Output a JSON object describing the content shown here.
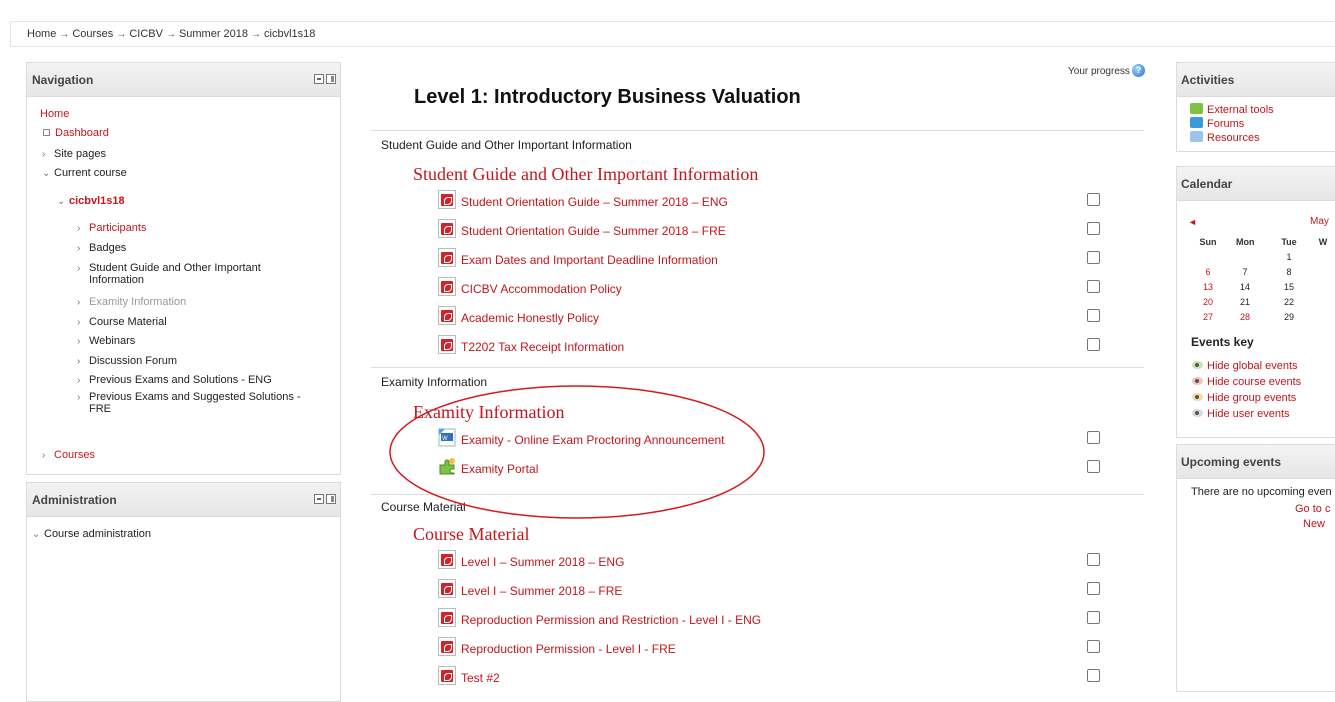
{
  "breadcrumb": [
    "Home",
    "Courses",
    "CICBV",
    "Summer 2018",
    "cicbvl1s18"
  ],
  "breadcrumb_sep": "→",
  "navigation": {
    "title": "Navigation",
    "home": "Home",
    "dashboard": "Dashboard",
    "site_pages": "Site pages",
    "current_course": "Current course",
    "course_code": "cicbvl1s18",
    "course_items": [
      "Participants",
      "Badges",
      "Student Guide and Other Important",
      "Information",
      "Examity Information",
      "Course Material",
      "Webinars",
      "Discussion Forum",
      "Previous Exams and Solutions - ENG",
      "Previous Exams and Suggested Solutions -",
      "FRE"
    ],
    "courses": "Courses"
  },
  "administration": {
    "title": "Administration",
    "course_admin": "Course administration"
  },
  "main": {
    "progress_label": "Your progress",
    "help_glyph": "?",
    "course_title": "Level 1: Introductory Business Valuation",
    "sections": [
      {
        "title": "Student Guide and Other Important Information",
        "heading": "Student Guide and Other Important Information",
        "activities": [
          "Student Orientation Guide – Summer 2018 – ENG",
          "Student Orientation Guide – Summer 2018 – FRE",
          "Exam Dates and Important Deadline Information",
          "CICBV Accommodation Policy",
          "Academic Honestly Policy",
          "T2202 Tax Receipt Information"
        ]
      },
      {
        "title": "Examity Information",
        "heading": "Examity Information",
        "activities": [
          "Examity - Online Exam Proctoring Announcement",
          "Examity Portal"
        ]
      },
      {
        "title": "Course Material",
        "heading": "Course Material",
        "activities": [
          "Level I – Summer 2018 – ENG",
          "Level I – Summer 2018 – FRE",
          "Reproduction Permission and Restriction - Level I - ENG",
          "Reproduction Permission - Level I - FRE",
          "Test #2"
        ]
      }
    ]
  },
  "activities_block": {
    "title": "Activities",
    "items": [
      "External tools",
      "Forums",
      "Resources"
    ]
  },
  "calendar": {
    "title": "Calendar",
    "month": "May",
    "prev_glyph": "◄",
    "days": [
      "Sun",
      "Mon",
      "Tue",
      "W"
    ],
    "rows": [
      [
        "",
        "",
        "1"
      ],
      [
        "6",
        "7",
        "8"
      ],
      [
        "13",
        "14",
        "15"
      ],
      [
        "20",
        "21",
        "22"
      ],
      [
        "27",
        "28",
        "29"
      ]
    ],
    "events_key_title": "Events key",
    "events": [
      "Hide global events",
      "Hide course events",
      "Hide group events",
      "Hide user events"
    ]
  },
  "upcoming": {
    "title": "Upcoming events",
    "empty_text": "There are no upcoming even",
    "goto": "Go to c",
    "new": "New"
  },
  "colors": {
    "link": "#c4161c",
    "annotation": "#d7191c"
  }
}
